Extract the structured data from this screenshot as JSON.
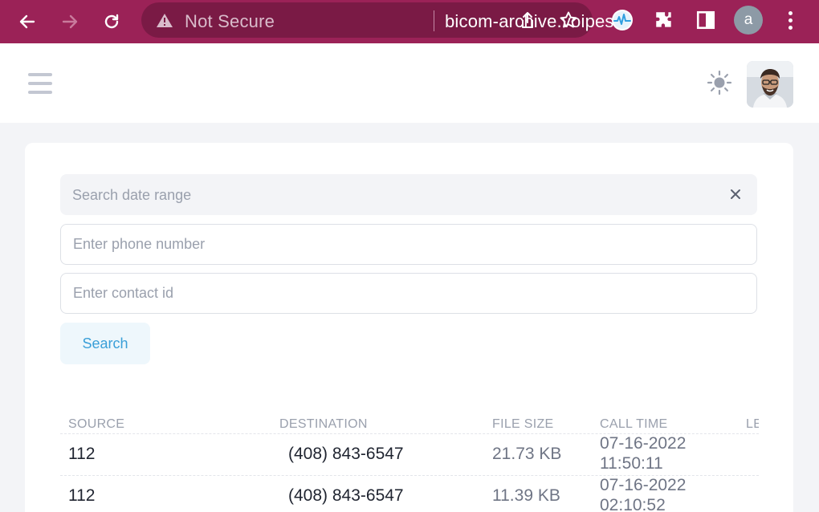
{
  "browser": {
    "security_label": "Not Secure",
    "url": "bicom-archive.voipes...",
    "profile_initial": "a"
  },
  "search": {
    "date_range_placeholder": "Search date range",
    "phone_placeholder": "Enter phone number",
    "contact_placeholder": "Enter contact id",
    "button_label": "Search"
  },
  "table": {
    "headers": {
      "source": "SOURCE",
      "destination": "DESTINATION",
      "file_size": "FILE SIZE",
      "call_time": "CALL TIME",
      "length": "LE"
    },
    "rows": [
      {
        "source": "112",
        "destination": "(408) 843-6547",
        "file_size": "21.73 KB",
        "call_date": "07-16-2022",
        "call_clock": "11:50:11"
      },
      {
        "source": "112",
        "destination": "(408) 843-6547",
        "file_size": "11.39 KB",
        "call_date": "07-16-2022",
        "call_clock": "02:10:52"
      }
    ]
  },
  "colors": {
    "browser_bar": "#9b2257",
    "omnibox": "#7a1a45",
    "accent": "#3a9fd8",
    "page_bg": "#f3f4f7"
  }
}
